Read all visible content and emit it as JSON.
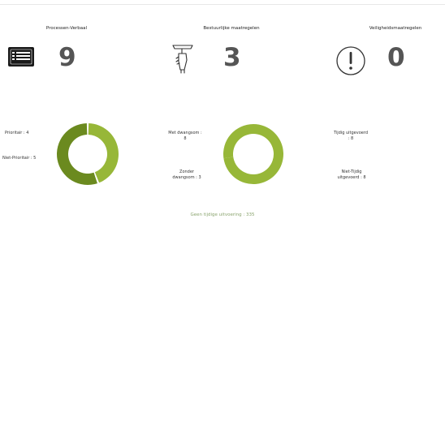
{
  "stats": [
    {
      "title": "Processen-Verbaal",
      "value": "9",
      "icon": "list-icon"
    },
    {
      "title": "Bestuurlijke maatregelen",
      "value": "3",
      "icon": "hammer-hand-icon"
    },
    {
      "title": "Veiligheidsmaatregelen",
      "value": "0",
      "icon": "exclamation-circle-icon"
    }
  ],
  "charts": {
    "prioriteit": {
      "labels": [
        "Prioritair : 4",
        "Niet-Prioritair : 5"
      ]
    },
    "dwangsom": {
      "labels": [
        "Met dwangsom :\n8",
        "Zonder\ndwangsom : 3"
      ]
    },
    "uitvoering": {
      "labels": [
        "Tijdig uitgevoerd\n: 8",
        "Niet-Tijdig\nuitgevoerd : 8"
      ]
    }
  },
  "footer_note": "Geen tijdige uitvoering : 335",
  "chart_data": [
    {
      "type": "pie",
      "title": "",
      "categories": [
        "Prioritair",
        "Niet-Prioritair"
      ],
      "values": [
        4,
        5
      ],
      "colors": [
        "#97b738",
        "#6b8a1f"
      ]
    },
    {
      "type": "pie",
      "title": "",
      "categories": [
        "Met dwangsom",
        "Zonder dwangsom"
      ],
      "values": [
        8,
        3
      ],
      "colors": [
        "#97b738",
        "#97b738"
      ]
    }
  ],
  "colors": {
    "accent_light": "#97b738",
    "accent_dark": "#6b8a1f",
    "value_text": "#555555",
    "footer_text": "#8aa46e",
    "icon_dark": "#1a1a1a"
  }
}
